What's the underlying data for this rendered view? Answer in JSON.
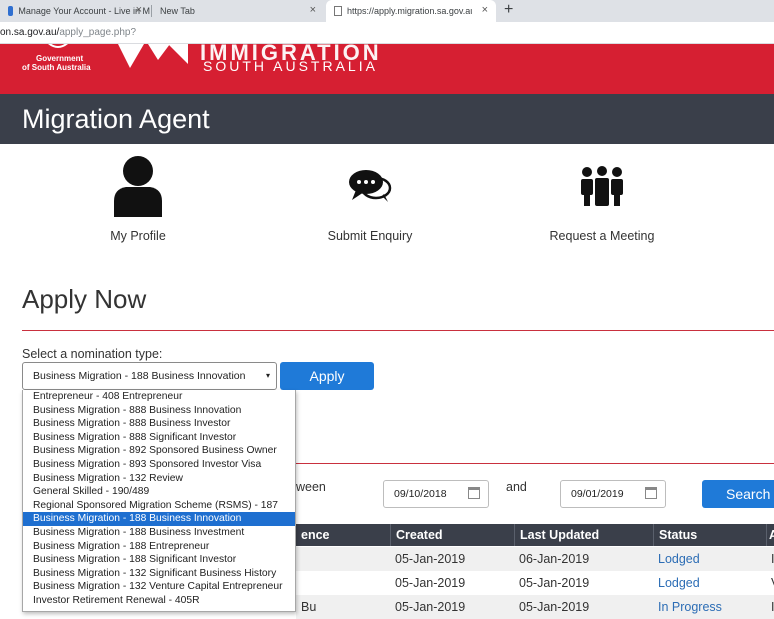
{
  "browser": {
    "tabs": [
      {
        "title": "Manage Your Account - Live in M",
        "active": false
      },
      {
        "title": "New Tab",
        "active": false
      },
      {
        "title": "https://apply.migration.sa.gov.au",
        "active": true
      }
    ],
    "new_tab_symbol": "+",
    "close_symbol": "×",
    "url": {
      "visible_prefix": "on.sa.gov.au/",
      "path": "apply_page.php?"
    }
  },
  "header": {
    "gov_line1": "Government",
    "gov_line2": "of South Australia",
    "brand_top": "IMMIGRATION",
    "brand_bottom": "SOUTH AUSTRALIA",
    "brand_color": "#d61f32"
  },
  "title_bar": {
    "title": "Migration Agent"
  },
  "tiles": [
    {
      "label": "My Profile",
      "icon": "user-icon"
    },
    {
      "label": "Submit Enquiry",
      "icon": "chat-bubbles-icon"
    },
    {
      "label": "Request a Meeting",
      "icon": "group-meeting-icon"
    }
  ],
  "apply": {
    "heading": "Apply Now",
    "nomination_label": "Select a nomination type:",
    "selected_value": "Business Migration - 188 Business Innovation",
    "caret": "▾",
    "apply_button": "Apply",
    "options": [
      "Entrepreneur - 408 Entrepreneur",
      "Business Migration - 888 Business Innovation",
      "Business Migration - 888 Business Investor",
      "Business Migration - 888 Significant Investor",
      "Business Migration - 892 Sponsored Business Owner",
      "Business Migration - 893 Sponsored Investor Visa",
      "Business Migration - 132 Review",
      "General Skilled - 190/489",
      "Regional Sponsored Migration Scheme (RSMS) - 187",
      "Business Migration - 188 Business Innovation",
      "Business Migration - 188 Business Investment",
      "Business Migration - 188 Entrepreneur",
      "Business Migration - 188 Significant Investor",
      "Business Migration - 132 Significant Business History",
      "Business Migration - 132 Venture Capital Entrepreneur",
      "Investor Retirement Renewal - 405R"
    ],
    "selected_index": 9
  },
  "search": {
    "between_label": "ween",
    "and_label": "and",
    "date_from": "09/10/2018",
    "date_to": "09/01/2019",
    "search_button": "Search"
  },
  "table": {
    "headers": [
      "ence",
      "Created",
      "Last Updated",
      "Status",
      "A"
    ],
    "rows": [
      {
        "ref": "",
        "created": "05-Jan-2019",
        "updated": "06-Jan-2019",
        "status": "Lodged",
        "extra": "I"
      },
      {
        "ref": "",
        "created": "05-Jan-2019",
        "updated": "05-Jan-2019",
        "status": "Lodged",
        "extra": "V"
      },
      {
        "ref": "Bu",
        "created": "05-Jan-2019",
        "updated": "05-Jan-2019",
        "status": "In Progress",
        "extra": "I"
      }
    ]
  }
}
